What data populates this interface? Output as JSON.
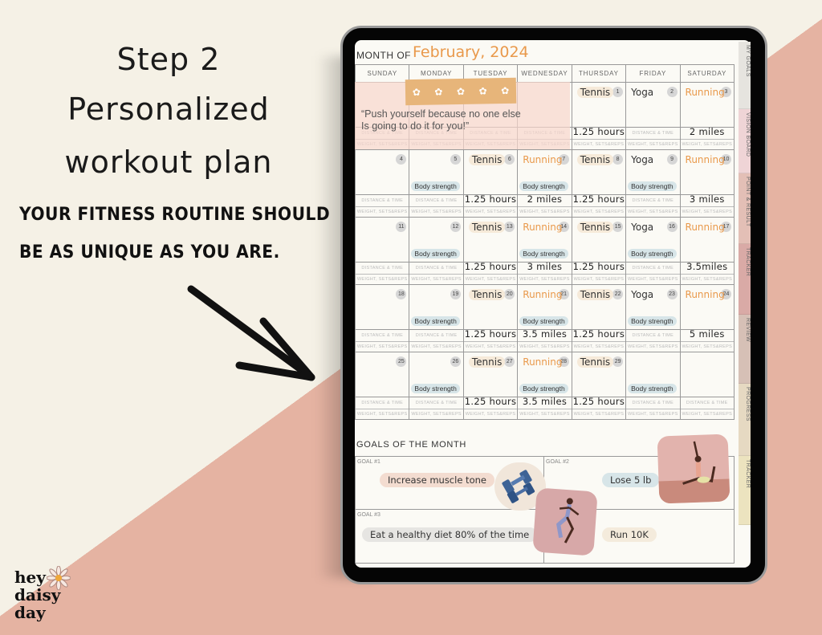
{
  "promo": {
    "step": "Step 2",
    "headline_line1": "Personalized",
    "headline_line2": "workout plan",
    "tagline_line1": "YOUR FITNESS ROUTINE SHOULD",
    "tagline_line2": "BE AS UNIQUE AS YOU ARE.",
    "brand_line1": "hey",
    "brand_line2": "daisy",
    "brand_line3": "day"
  },
  "colors": {
    "background_cream": "#f5f1e6",
    "background_pink": "#e5b3a2",
    "accent_orange": "#e9994b",
    "strength_tag": "#d7e5e8"
  },
  "planner": {
    "month_of_label": "MONTH OF",
    "month_title": "February, 2024",
    "weekdays": [
      "SUNDAY",
      "MONDAY",
      "TUESDAY",
      "WEDNESDAY",
      "THURSDAY",
      "FRIDAY",
      "SATURDAY"
    ],
    "distance_label": "DISTANCE & TIME",
    "weight_label": "WEIGHT, SETS&REPS",
    "quote_line1": "“Push yourself because no one else",
    "quote_line2": "Is going to do it for you!”",
    "weeks": [
      [
        null,
        null,
        null,
        null,
        {
          "day": "1",
          "activity": "Tennis",
          "type": "tennis",
          "distance": "1.25 hours"
        },
        {
          "day": "2",
          "activity": "Yoga",
          "type": "yoga"
        },
        {
          "day": "3",
          "activity": "Running",
          "type": "run",
          "distance": "2 miles"
        }
      ],
      [
        {
          "day": "4"
        },
        {
          "day": "5",
          "strength": "Body strength"
        },
        {
          "day": "6",
          "activity": "Tennis",
          "type": "tennis",
          "distance": "1.25 hours"
        },
        {
          "day": "7",
          "activity": "Running",
          "type": "run",
          "strength": "Body strength",
          "distance": "2 miles"
        },
        {
          "day": "8",
          "activity": "Tennis",
          "type": "tennis",
          "distance": "1.25 hours"
        },
        {
          "day": "9",
          "activity": "Yoga",
          "type": "yoga",
          "strength": "Body strength"
        },
        {
          "day": "10",
          "activity": "Running",
          "type": "run",
          "distance": "3 miles"
        }
      ],
      [
        {
          "day": "11"
        },
        {
          "day": "12",
          "strength": "Body strength"
        },
        {
          "day": "13",
          "activity": "Tennis",
          "type": "tennis",
          "distance": "1.25 hours"
        },
        {
          "day": "14",
          "activity": "Running",
          "type": "run",
          "strength": "Body strength",
          "distance": "3 miles"
        },
        {
          "day": "15",
          "activity": "Tennis",
          "type": "tennis",
          "distance": "1.25 hours"
        },
        {
          "day": "16",
          "activity": "Yoga",
          "type": "yoga",
          "strength": "Body strength"
        },
        {
          "day": "17",
          "activity": "Running",
          "type": "run",
          "distance": "3.5miles"
        }
      ],
      [
        {
          "day": "18"
        },
        {
          "day": "19",
          "strength": "Body strength"
        },
        {
          "day": "20",
          "activity": "Tennis",
          "type": "tennis",
          "distance": "1.25 hours"
        },
        {
          "day": "21",
          "activity": "Running",
          "type": "run",
          "strength": "Body strength",
          "distance": "3.5 miles"
        },
        {
          "day": "22",
          "activity": "Tennis",
          "type": "tennis",
          "distance": "1.25 hours"
        },
        {
          "day": "23",
          "activity": "Yoga",
          "type": "yoga",
          "strength": "Body strength"
        },
        {
          "day": "24",
          "activity": "Running",
          "type": "run",
          "distance": "5 miles"
        }
      ],
      [
        {
          "day": "25"
        },
        {
          "day": "26",
          "strength": "Body strength"
        },
        {
          "day": "27",
          "activity": "Tennis",
          "type": "tennis",
          "distance": "1.25 hours"
        },
        {
          "day": "28",
          "activity": "Running",
          "type": "run",
          "strength": "Body strength",
          "distance": "3.5 miles"
        },
        {
          "day": "29",
          "activity": "Tennis",
          "type": "tennis",
          "distance": "1.25 hours"
        },
        {
          "strength": "Body strength"
        },
        {}
      ]
    ],
    "goals_title": "GOALS OF THE MONTH",
    "goals": [
      {
        "label": "GOAL #1",
        "text": "Increase muscle tone"
      },
      {
        "label": "GOAL #2",
        "text": "Lose 5 lb"
      },
      {
        "label": "GOAL #3",
        "text": "Eat a healthy diet 80% of the time"
      },
      {
        "label": "",
        "text": "Run 10K"
      }
    ]
  },
  "side_tabs": [
    {
      "label": "MY GOALS",
      "color": "#e6e4df"
    },
    {
      "label": "VISION BOARD",
      "color": "#efd4d6"
    },
    {
      "label": "POINT & RESULT",
      "color": "#e3bfb6"
    },
    {
      "label": "TRACKER",
      "color": "#d9aaa6"
    },
    {
      "label": "REVIEW",
      "color": "#d6c0b6"
    },
    {
      "label": "PROGRESS",
      "color": "#e6d9c2"
    },
    {
      "label": "TRACKER",
      "color": "#ece3bf"
    }
  ]
}
